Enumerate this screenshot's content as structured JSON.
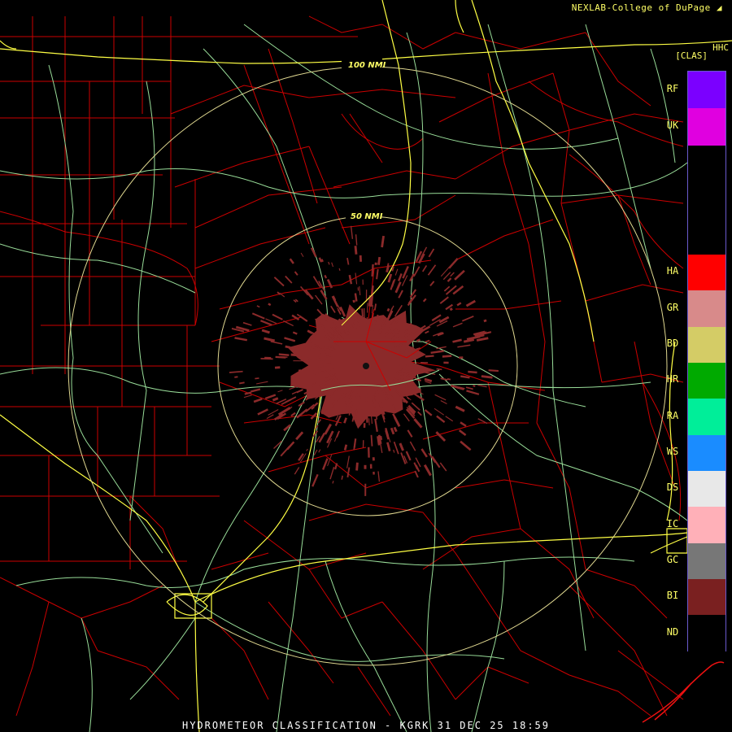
{
  "header": {
    "credit": "NEXLAB-College of DuPage",
    "product_code": "HHC",
    "class_label": "[CLAS]"
  },
  "footer": {
    "title": "HYDROMETEOR CLASSIFICATION - KGRK 31 DEC 25 18:59"
  },
  "range_rings": [
    {
      "label": "100 NMI"
    },
    {
      "label": "50 NMI"
    }
  ],
  "legend": [
    {
      "code": "RF",
      "color": "#7b00ff"
    },
    {
      "code": "UK",
      "color": "#e000e0"
    },
    {
      "code": "HA",
      "color": "#ff0000"
    },
    {
      "code": "GR",
      "color": "#d88a8a"
    },
    {
      "code": "BD",
      "color": "#d4cc66"
    },
    {
      "code": "HR",
      "color": "#00aa00"
    },
    {
      "code": "RA",
      "color": "#00ee99"
    },
    {
      "code": "WS",
      "color": "#1a8cff"
    },
    {
      "code": "DS",
      "color": "#e8e8e8"
    },
    {
      "code": "IC",
      "color": "#ffb0b8"
    },
    {
      "code": "GC",
      "color": "#777777"
    },
    {
      "code": "BI",
      "color": "#7a2020"
    },
    {
      "code": "ND",
      "color": "#000000"
    }
  ],
  "colors": {
    "county_lines": "#cc0000",
    "highways": "#ffff44",
    "roads": "#99dd99",
    "rings": "#e0d890",
    "echo": "#8b2a2a"
  }
}
